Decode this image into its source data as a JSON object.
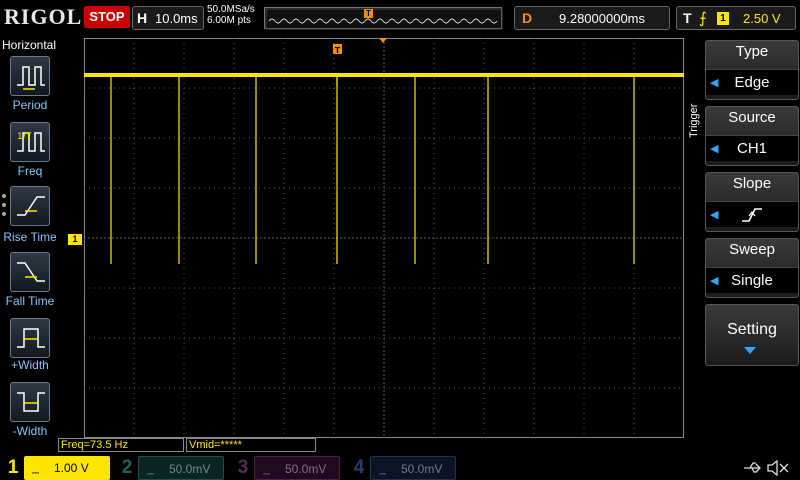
{
  "topbar": {
    "logo": "RIGOL",
    "run_state": "STOP",
    "horizontal_label": "H",
    "timebase": "10.0ms",
    "sample_rate": "50.0MSa/s",
    "memory_depth": "6.00M pts",
    "trigger_pos_marker": "T",
    "delay_label": "D",
    "delay_value": "9.28000000ms",
    "trigger_label": "T",
    "trigger_source_badge": "1",
    "trigger_level": "2.50 V"
  },
  "left_panel": {
    "title": "Horizontal",
    "items": [
      {
        "label": "Period",
        "icon": "period-icon"
      },
      {
        "label": "Freq",
        "icon": "freq-icon"
      },
      {
        "label": "Rise Time",
        "icon": "rise-time-icon"
      },
      {
        "label": "Fall Time",
        "icon": "fall-time-icon"
      },
      {
        "label": "+Width",
        "icon": "pos-width-icon"
      },
      {
        "label": "-Width",
        "icon": "neg-width-icon"
      }
    ]
  },
  "waveform": {
    "channel_marker": "1",
    "trigger_marker": "T",
    "color": "#ffe600",
    "grid_color": "#5a5a5a"
  },
  "right_panel": {
    "side_label": "Trigger",
    "type": {
      "label": "Type",
      "value": "Edge"
    },
    "source": {
      "label": "Source",
      "value": "CH1"
    },
    "slope": {
      "label": "Slope",
      "icon": "rising-edge-icon"
    },
    "sweep": {
      "label": "Sweep",
      "value": "Single"
    },
    "setting": {
      "label": "Setting"
    }
  },
  "status": {
    "freq": "Freq=73.5 Hz",
    "vmid": "Vmid=*****"
  },
  "channels": [
    {
      "num": "1",
      "scale": "1.00 V",
      "color": "#ffe600",
      "active": true
    },
    {
      "num": "2",
      "scale": "50.0mV",
      "color": "#17a3a3",
      "active": false
    },
    {
      "num": "3",
      "scale": "50.0mV",
      "color": "#c040c0",
      "active": false
    },
    {
      "num": "4",
      "scale": "50.0mV",
      "color": "#3070e0",
      "active": false
    }
  ]
}
